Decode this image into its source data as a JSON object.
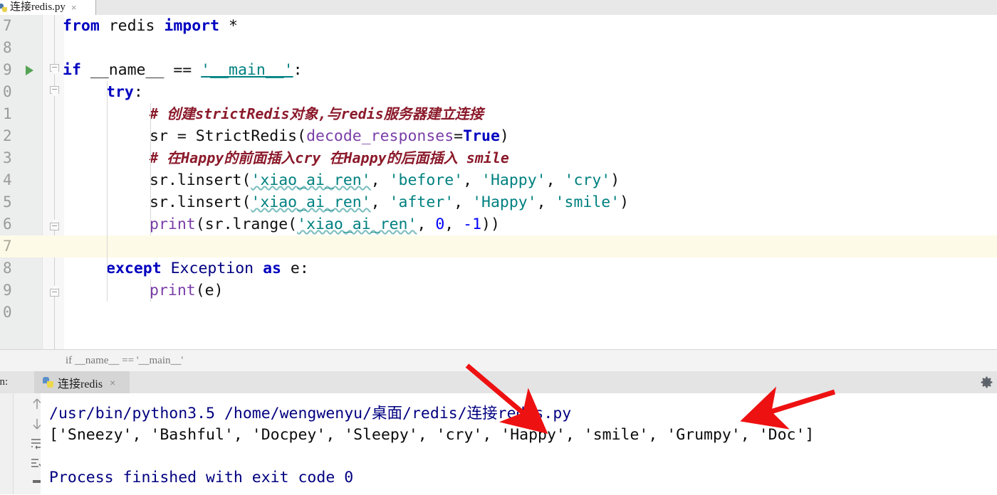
{
  "editor_tab": {
    "icon": "python-file-icon",
    "label": "连接redis.py",
    "close": "×"
  },
  "editor": {
    "lines": [
      {
        "num": "7",
        "indent": 0
      },
      {
        "num": "8",
        "indent": 0
      },
      {
        "num": "9",
        "indent": 0
      },
      {
        "num": "0",
        "indent": 0
      },
      {
        "num": "1",
        "indent": 0
      },
      {
        "num": "2",
        "indent": 0
      },
      {
        "num": "3",
        "indent": 0
      },
      {
        "num": "4",
        "indent": 0
      },
      {
        "num": "5",
        "indent": 0
      },
      {
        "num": "6",
        "indent": 0
      },
      {
        "num": "7",
        "indent": 0
      },
      {
        "num": "8",
        "indent": 0
      },
      {
        "num": "9",
        "indent": 0
      },
      {
        "num": "0",
        "indent": 0
      }
    ],
    "code": {
      "l7": "from redis import *",
      "l8": "",
      "l9": "if __name__ == '__main__':",
      "l10": "    try:",
      "l11": "        # 创建strictRedis对象,与redis服务器建立连接",
      "l12": "        sr = StrictRedis(decode_responses=True)",
      "l13": "        # 在Happy的前面插入cry 在Happy的后面插入 smile",
      "l14": "        sr.linsert('xiao_ai_ren', 'before', 'Happy', 'cry')",
      "l15": "        sr.linsert('xiao_ai_ren', 'after', 'Happy', 'smile')",
      "l16": "        print(sr.lrange('xiao_ai_ren', 0, -1))",
      "l17": "",
      "l18": "    except Exception as e:",
      "l19": "        print(e)",
      "l20": ""
    },
    "tokens": {
      "from": "from",
      "redis": " redis ",
      "import": "import",
      "star": " *",
      "if": "if",
      "name": " __name__ == ",
      "main": "'__main__'",
      "colon": ":",
      "try": "try",
      "comment1": "# 创建strictRedis对象,与redis服务器建立连接",
      "sr_assign": "sr = StrictRedis(",
      "decode_responses": "decode_responses",
      "eq": "=",
      "true": "True",
      "rparen": ")",
      "comment2": "# 在Happy的前面插入cry 在Happy的后面插入 smile",
      "sr_linsert": "sr.linsert(",
      "xiao_ai_ren": "'xiao_ai_ren'",
      "before": "'before'",
      "after": "'after'",
      "happy": "'Happy'",
      "cry": "'cry'",
      "smile": "'smile'",
      "comma": ", ",
      "print": "print",
      "lparen": "(",
      "sr_lrange": "sr.lrange(",
      "zero": "0",
      "minus_one": "-1",
      "rparen2": "))",
      "except": "except",
      "exception": " Exception ",
      "as": "as",
      "e_colon": " e:",
      "print_e": "(e)"
    },
    "highlighted_line": "7",
    "run_marker": "run-gutter-arrow"
  },
  "breadcrumb": {
    "text": "if __name__ == '__main__'"
  },
  "run_window": {
    "label": "un:",
    "tab": {
      "icon": "python-run-icon",
      "label": "连接redis",
      "close": "×"
    },
    "gear": "settings-gear-icon",
    "side_buttons": [
      {
        "name": "scroll-up-icon",
        "glyph": "↑"
      },
      {
        "name": "scroll-down-icon",
        "glyph": "↓"
      },
      {
        "name": "soft-wrap-icon",
        "glyph": "⇥"
      },
      {
        "name": "scroll-to-end-icon",
        "glyph": "⇲"
      },
      {
        "name": "print-icon",
        "glyph": "▭"
      }
    ],
    "console": [
      {
        "text": "/usr/bin/python3.5 /home/wengwenyu/桌面/redis/连接redis.py",
        "color": "blue"
      },
      {
        "text": "['Sneezy', 'Bashful', 'Docpey', 'Sleepy', 'cry', 'Happy', 'smile', 'Grumpy', 'Doc']",
        "color": "black"
      },
      {
        "text": "",
        "color": "black"
      },
      {
        "text": "Process finished with exit code 0",
        "color": "blue"
      }
    ]
  },
  "annotations": {
    "arrow_color": "#ee1111",
    "arrow1": "points to 连接redis.py in command path",
    "arrow2": "points to 'smile' in output list"
  }
}
